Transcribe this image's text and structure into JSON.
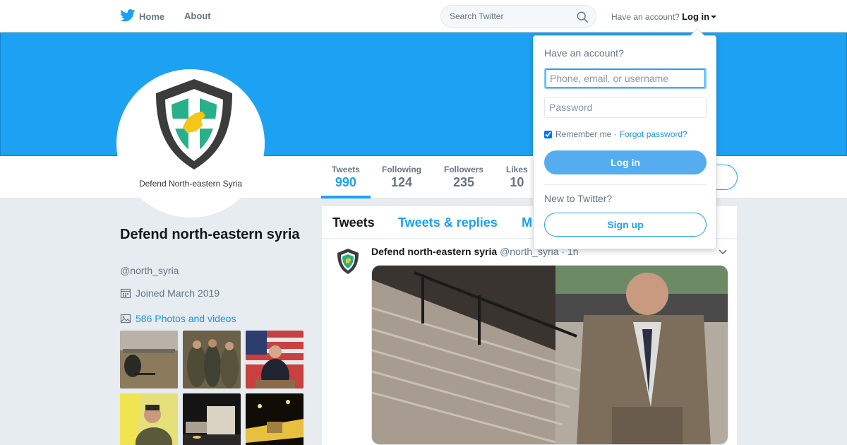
{
  "nav": {
    "home_label": "Home",
    "about_label": "About",
    "search_placeholder": "Search Twitter",
    "have_account": "Have an account?",
    "login_label": "Log in"
  },
  "profile": {
    "name": "Defend north-eastern syria",
    "handle": "@north_syria",
    "joined": "Joined March 2019",
    "photos": "586 Photos and videos",
    "avatar_text": "Defend North-eastern Syria"
  },
  "stats": [
    {
      "label": "Tweets",
      "value": "990"
    },
    {
      "label": "Following",
      "value": "124"
    },
    {
      "label": "Followers",
      "value": "235"
    },
    {
      "label": "Likes",
      "value": "10"
    }
  ],
  "tabs": [
    "Tweets",
    "Tweets & replies",
    "M"
  ],
  "tweet": {
    "name": "Defend north-eastern syria",
    "handle": "@north_syria",
    "time": "· 1h"
  },
  "login_dropdown": {
    "title": "Have an account?",
    "username_placeholder": "Phone, email, or username",
    "password_placeholder": "Password",
    "remember": "Remember me ·",
    "forgot": "Forgot password?",
    "login_button": "Log in",
    "new_to": "New to Twitter?",
    "signup_button": "Sign up"
  },
  "colors": {
    "brand": "#1da1f2",
    "login_button": "#55acee",
    "background": "#e6ecf0"
  }
}
